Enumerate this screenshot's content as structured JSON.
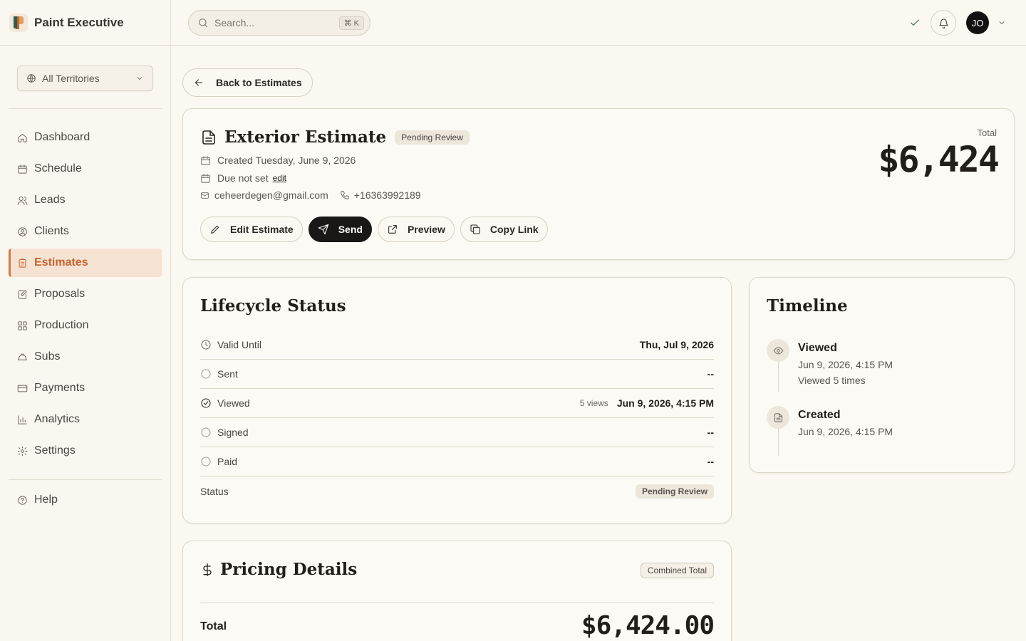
{
  "brand": {
    "name": "Paint Executive"
  },
  "sidebar": {
    "territory": "All Territories",
    "items": [
      {
        "label": "Dashboard",
        "icon": "home-icon"
      },
      {
        "label": "Schedule",
        "icon": "calendar-icon"
      },
      {
        "label": "Leads",
        "icon": "users-icon"
      },
      {
        "label": "Clients",
        "icon": "user-circle-icon"
      },
      {
        "label": "Estimates",
        "icon": "clipboard-icon",
        "active": true
      },
      {
        "label": "Proposals",
        "icon": "edit-doc-icon"
      },
      {
        "label": "Production",
        "icon": "grid-icon"
      },
      {
        "label": "Subs",
        "icon": "hard-hat-icon"
      },
      {
        "label": "Payments",
        "icon": "credit-card-icon"
      },
      {
        "label": "Analytics",
        "icon": "bar-chart-icon"
      },
      {
        "label": "Settings",
        "icon": "gear-icon"
      }
    ],
    "help": "Help"
  },
  "header": {
    "search_placeholder": "Search...",
    "shortcut": "⌘ K",
    "avatar_initials": "JO"
  },
  "back_label": "Back to Estimates",
  "estimate": {
    "title": "Exterior Estimate",
    "status_badge": "Pending Review",
    "created": "Created Tuesday, June 9, 2026",
    "due": "Due not set",
    "due_edit": "edit",
    "email": "ceheerdegen@gmail.com",
    "phone": "+16363992189",
    "total_label": "Total",
    "total_value": "$6,424",
    "actions": {
      "edit": "Edit Estimate",
      "send": "Send",
      "preview": "Preview",
      "copy": "Copy Link"
    }
  },
  "lifecycle": {
    "title": "Lifecycle Status",
    "rows": [
      {
        "name": "Valid Until",
        "value": "Thu, Jul 9, 2026"
      },
      {
        "name": "Sent",
        "value": "--"
      },
      {
        "name": "Viewed",
        "views": "5 views",
        "value": "Jun 9, 2026, 4:15 PM"
      },
      {
        "name": "Signed",
        "value": "--"
      },
      {
        "name": "Paid",
        "value": "--"
      }
    ],
    "status_label": "Status",
    "status_value": "Pending Review"
  },
  "timeline": {
    "title": "Timeline",
    "items": [
      {
        "title": "Viewed",
        "time": "Jun 9, 2026, 4:15 PM",
        "note": "Viewed 5 times"
      },
      {
        "title": "Created",
        "time": "Jun 9, 2026, 4:15 PM"
      }
    ]
  },
  "pricing": {
    "title": "Pricing Details",
    "badge": "Combined Total",
    "total_label": "Total",
    "total_value": "$6,424.00"
  },
  "colors": {
    "accent": "#c4652f",
    "accent_bg": "#f6e2d3",
    "dark": "#1a1816"
  }
}
